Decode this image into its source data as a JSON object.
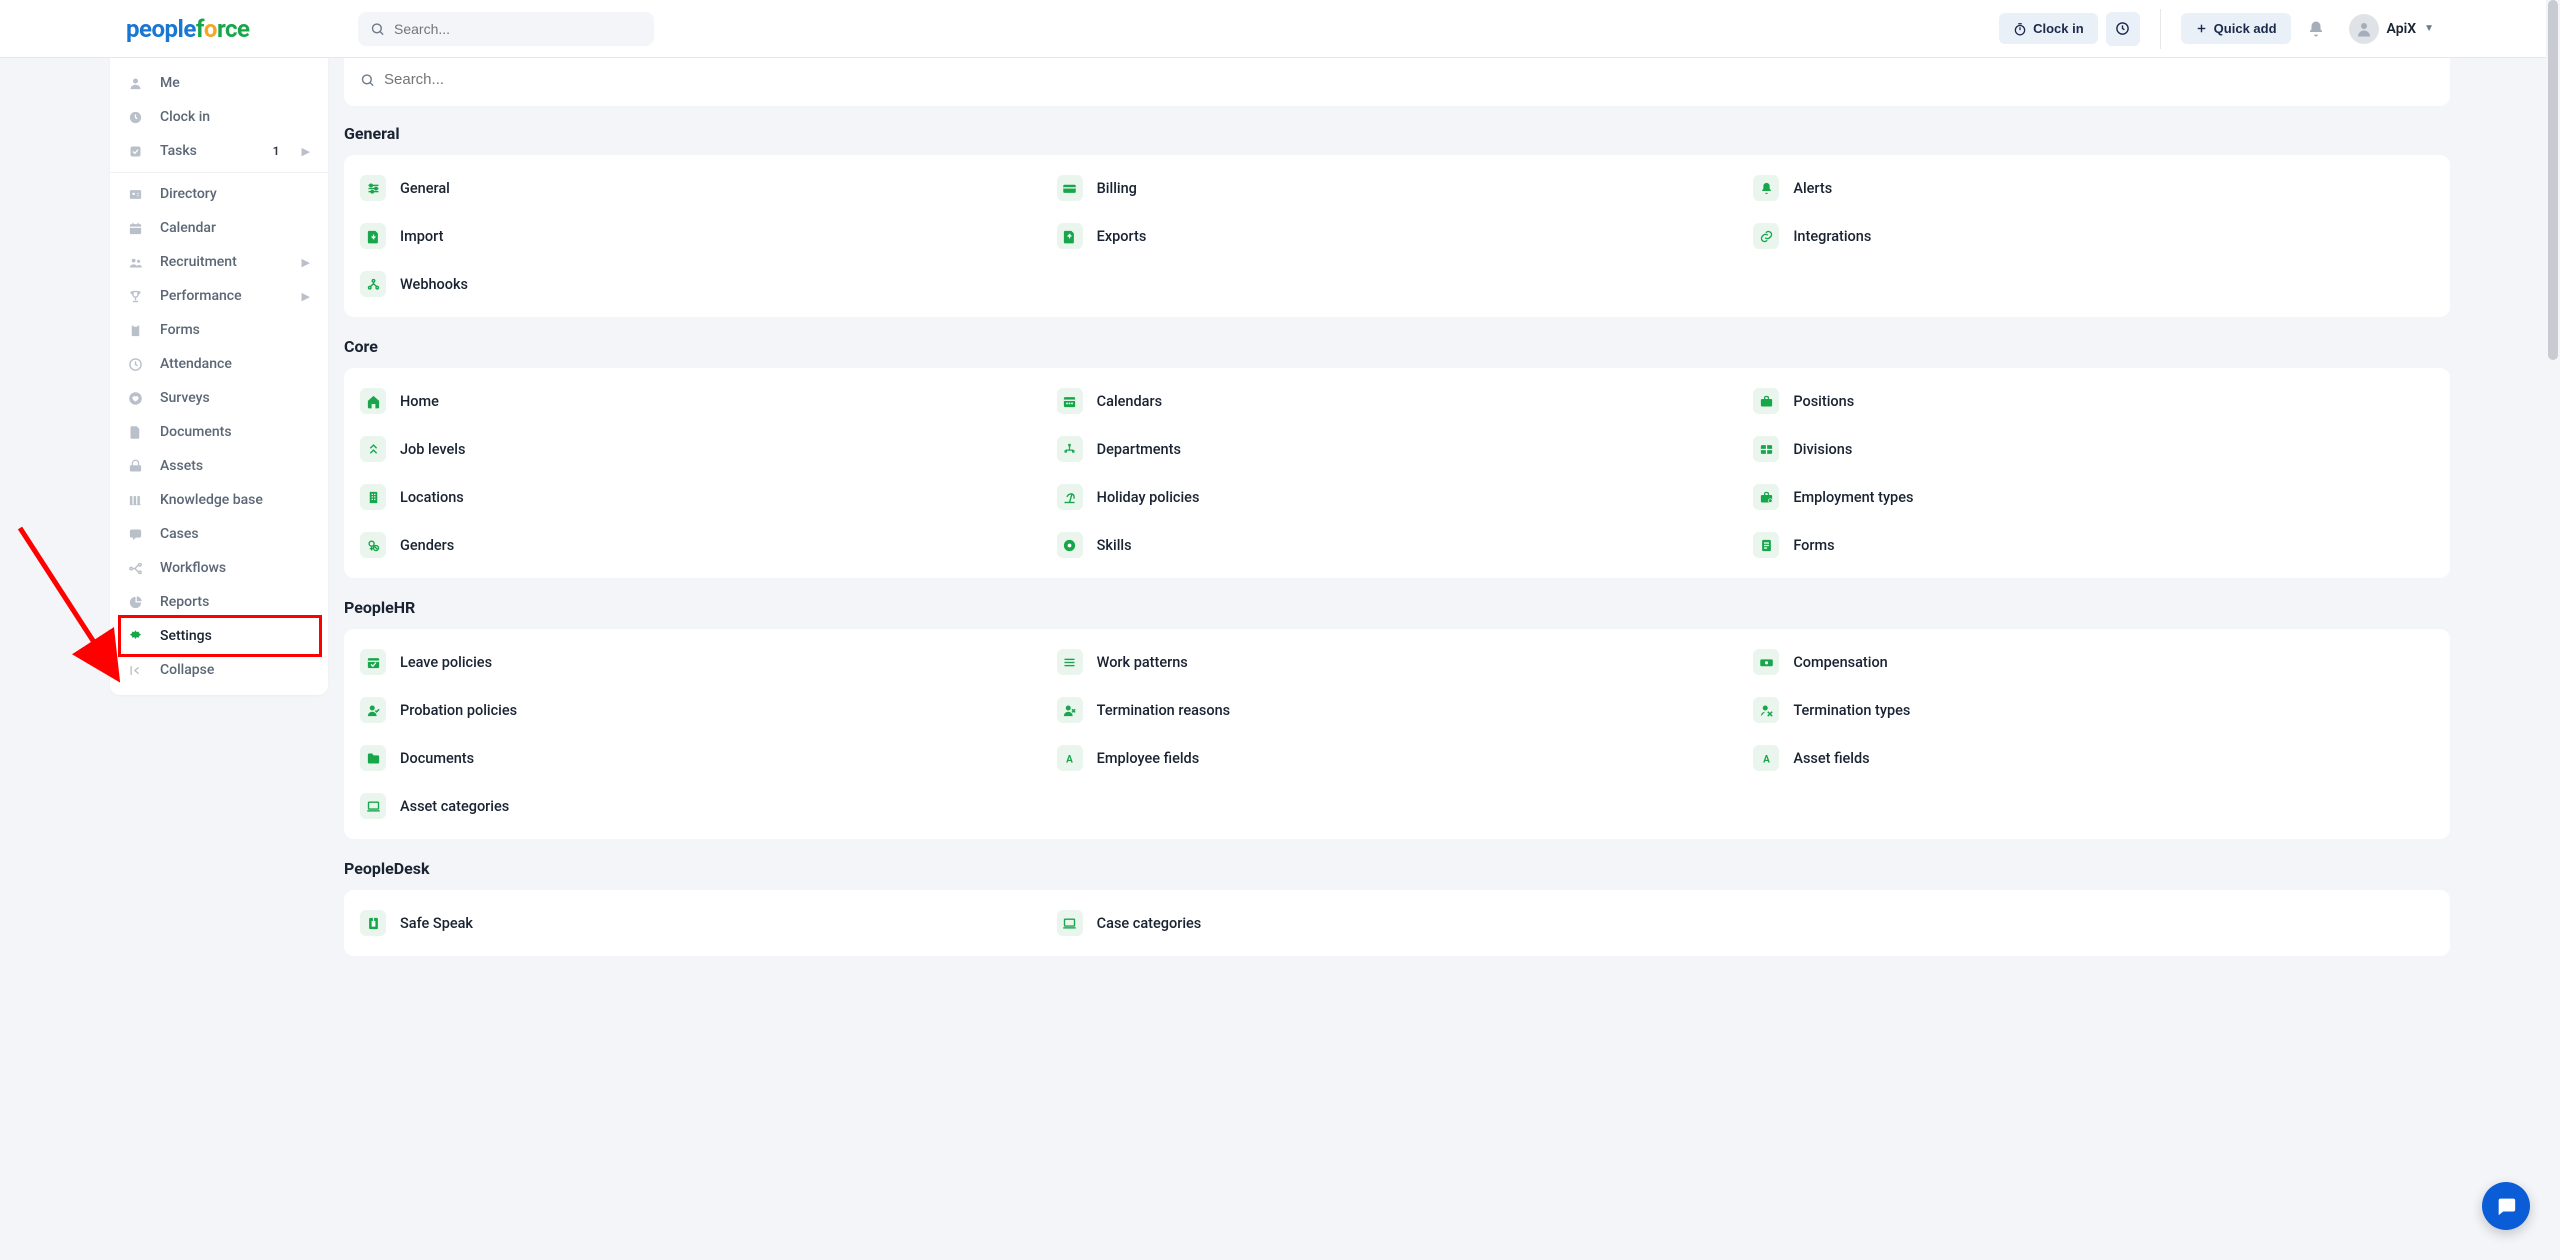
{
  "header": {
    "search_placeholder": "Search...",
    "clock_in": "Clock in",
    "quick_add": "Quick add",
    "user_name": "ApiX"
  },
  "sidebar": {
    "items": [
      {
        "label": "Me",
        "icon": "user-icon"
      },
      {
        "label": "Clock in",
        "icon": "clock-icon"
      },
      {
        "label": "Tasks",
        "icon": "check-icon",
        "badge": "1",
        "chevron": true
      },
      {
        "label": "Directory",
        "icon": "id-card-icon"
      },
      {
        "label": "Calendar",
        "icon": "calendar-icon"
      },
      {
        "label": "Recruitment",
        "icon": "people-icon",
        "chevron": true
      },
      {
        "label": "Performance",
        "icon": "trophy-icon",
        "chevron": true
      },
      {
        "label": "Forms",
        "icon": "clipboard-icon"
      },
      {
        "label": "Attendance",
        "icon": "clock2-icon"
      },
      {
        "label": "Surveys",
        "icon": "heart-icon"
      },
      {
        "label": "Documents",
        "icon": "file-icon"
      },
      {
        "label": "Assets",
        "icon": "assets-icon"
      },
      {
        "label": "Knowledge base",
        "icon": "books-icon"
      },
      {
        "label": "Cases",
        "icon": "chat-icon"
      },
      {
        "label": "Workflows",
        "icon": "flow-icon"
      },
      {
        "label": "Reports",
        "icon": "chart-icon"
      },
      {
        "label": "Settings",
        "icon": "gear-icon",
        "active": true
      },
      {
        "label": "Collapse",
        "icon": "collapse-icon"
      }
    ]
  },
  "main": {
    "search_placeholder": "Search...",
    "sections": [
      {
        "title": "General",
        "items": [
          {
            "label": "General",
            "icon": "sliders-icon"
          },
          {
            "label": "Billing",
            "icon": "creditcard-icon"
          },
          {
            "label": "Alerts",
            "icon": "bell-icon"
          },
          {
            "label": "Import",
            "icon": "import-icon"
          },
          {
            "label": "Exports",
            "icon": "export-icon"
          },
          {
            "label": "Integrations",
            "icon": "link-icon"
          },
          {
            "label": "Webhooks",
            "icon": "webhook-icon"
          }
        ]
      },
      {
        "title": "Core",
        "items": [
          {
            "label": "Home",
            "icon": "home-icon"
          },
          {
            "label": "Calendars",
            "icon": "calendar2-icon"
          },
          {
            "label": "Positions",
            "icon": "briefcase-icon"
          },
          {
            "label": "Job levels",
            "icon": "levels-icon"
          },
          {
            "label": "Departments",
            "icon": "org-icon"
          },
          {
            "label": "Divisions",
            "icon": "divisions-icon"
          },
          {
            "label": "Locations",
            "icon": "building-icon"
          },
          {
            "label": "Holiday policies",
            "icon": "holiday-icon"
          },
          {
            "label": "Employment types",
            "icon": "emptypes-icon"
          },
          {
            "label": "Genders",
            "icon": "genders-icon"
          },
          {
            "label": "Skills",
            "icon": "skills-icon"
          },
          {
            "label": "Forms",
            "icon": "forms2-icon"
          }
        ]
      },
      {
        "title": "PeopleHR",
        "items": [
          {
            "label": "Leave policies",
            "icon": "leave-icon"
          },
          {
            "label": "Work patterns",
            "icon": "pattern-icon"
          },
          {
            "label": "Compensation",
            "icon": "money-icon"
          },
          {
            "label": "Probation policies",
            "icon": "probation-icon"
          },
          {
            "label": "Termination reasons",
            "icon": "termreason-icon"
          },
          {
            "label": "Termination types",
            "icon": "termtype-icon"
          },
          {
            "label": "Documents",
            "icon": "folder-icon"
          },
          {
            "label": "Employee fields",
            "icon": "field-a-icon"
          },
          {
            "label": "Asset fields",
            "icon": "field-a-icon"
          },
          {
            "label": "Asset categories",
            "icon": "laptop-icon"
          }
        ]
      },
      {
        "title": "PeopleDesk",
        "items": [
          {
            "label": "Safe Speak",
            "icon": "safespeak-icon"
          },
          {
            "label": "Case categories",
            "icon": "laptop-icon"
          }
        ]
      }
    ]
  }
}
